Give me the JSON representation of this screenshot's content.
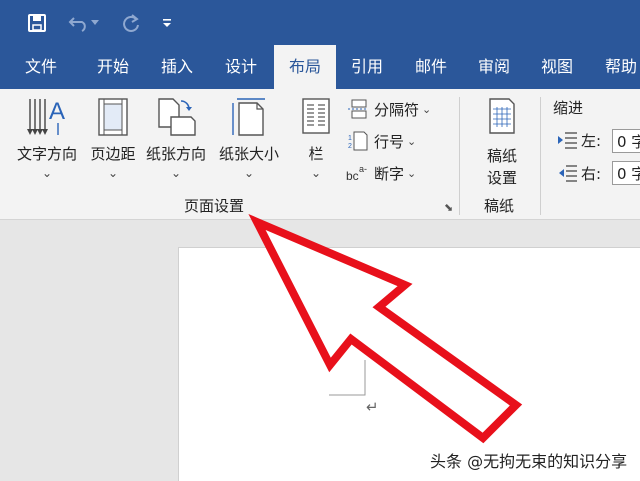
{
  "colors": {
    "title_bar": "#2b579a",
    "ribbon_bg": "#f3f3f3",
    "arrow": "#e8101b",
    "doc_bg": "#e6e6e6"
  },
  "quick_access": {
    "icons": [
      "save-icon",
      "undo-icon",
      "redo-icon",
      "customize-icon"
    ]
  },
  "tabs": [
    {
      "label": "文件"
    },
    {
      "label": "开始"
    },
    {
      "label": "插入"
    },
    {
      "label": "设计"
    },
    {
      "label": "布局",
      "active": true
    },
    {
      "label": "引用"
    },
    {
      "label": "邮件"
    },
    {
      "label": "审阅"
    },
    {
      "label": "视图"
    },
    {
      "label": "帮助"
    }
  ],
  "page_setup": {
    "text_direction": "文字方向",
    "margins": "页边距",
    "orientation": "纸张方向",
    "size": "纸张大小",
    "columns": "栏",
    "breaks": "分隔符",
    "line_numbers": "行号",
    "hyphenation": "断字",
    "group_label": "页面设置"
  },
  "manuscript": {
    "button_line1": "稿纸",
    "button_line2": "设置",
    "group_label": "稿纸"
  },
  "indent": {
    "title": "缩进",
    "left_label": "左:",
    "left_value": "0 字",
    "right_label": "右:",
    "right_value": "0 字"
  },
  "document": {
    "paragraph_mark": "↵"
  },
  "watermark": "头条 @无拘无束的知识分享"
}
